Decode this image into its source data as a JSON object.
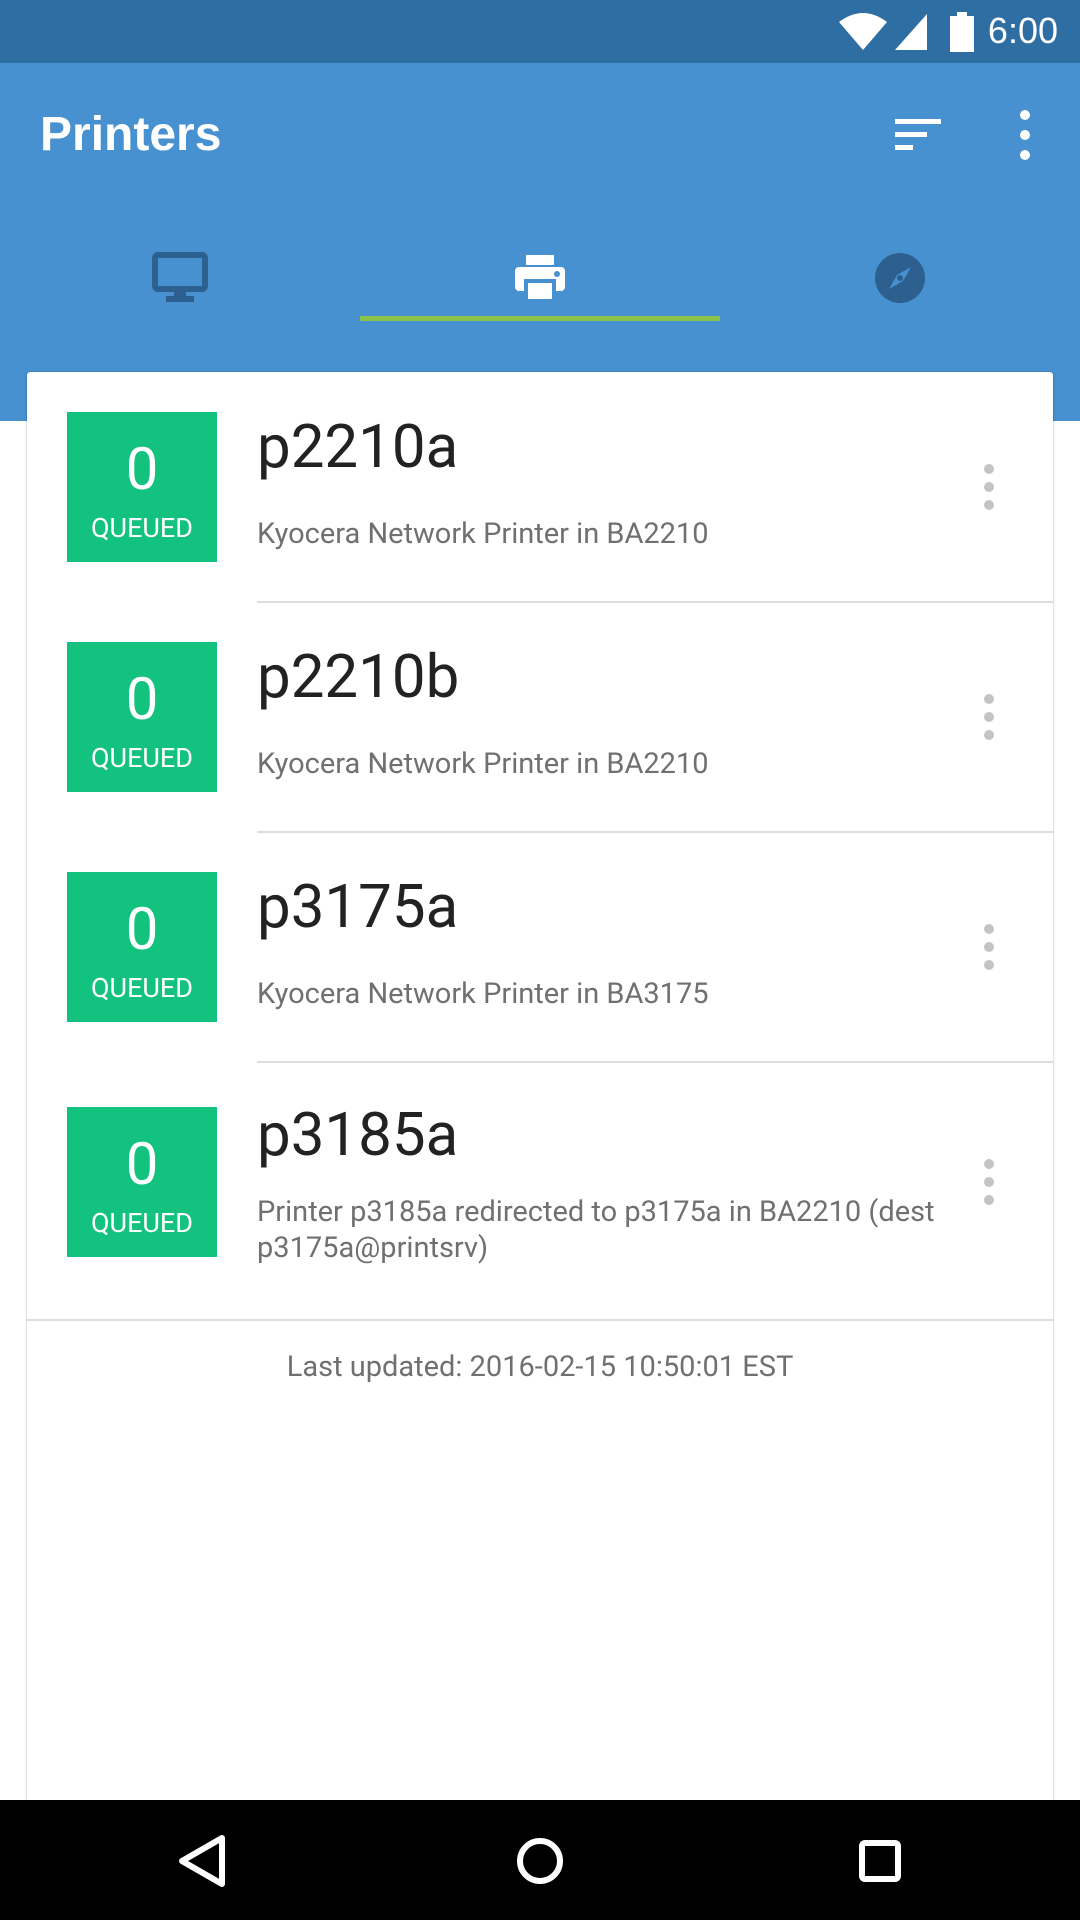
{
  "status_bar": {
    "time": "6:00",
    "icons": [
      "wifi-icon",
      "signal-icon",
      "battery-icon"
    ]
  },
  "app_bar": {
    "title": "Printers",
    "actions": [
      "sort-icon",
      "overflow-menu-icon"
    ],
    "tabs": [
      {
        "name": "computers",
        "icon": "monitor-icon",
        "selected": false
      },
      {
        "name": "printers",
        "icon": "printer-icon",
        "selected": true
      },
      {
        "name": "explore",
        "icon": "compass-icon",
        "selected": false
      }
    ]
  },
  "printers": [
    {
      "queue_count": "0",
      "queue_label": "QUEUED",
      "name": "p2210a",
      "description": "Kyocera Network Printer in BA2210"
    },
    {
      "queue_count": "0",
      "queue_label": "QUEUED",
      "name": "p2210b",
      "description": "Kyocera Network Printer in BA2210"
    },
    {
      "queue_count": "0",
      "queue_label": "QUEUED",
      "name": "p3175a",
      "description": "Kyocera Network Printer in BA3175"
    },
    {
      "queue_count": "0",
      "queue_label": "QUEUED",
      "name": "p3185a",
      "description": "Printer p3185a redirected to p3175a in BA2210 (dest p3175a@printsrv)"
    }
  ],
  "footer": {
    "last_updated": "Last updated: 2016-02-15 10:50:01 EST"
  },
  "colors": {
    "status_bar": "#2e6ea3",
    "app_bar": "#4791d0",
    "tab_indicator": "#8bc34a",
    "queue_badge": "#13c27e",
    "nav_bar": "#000000"
  },
  "nav_bar": {
    "buttons": [
      "back-icon",
      "home-icon",
      "recents-icon"
    ]
  }
}
